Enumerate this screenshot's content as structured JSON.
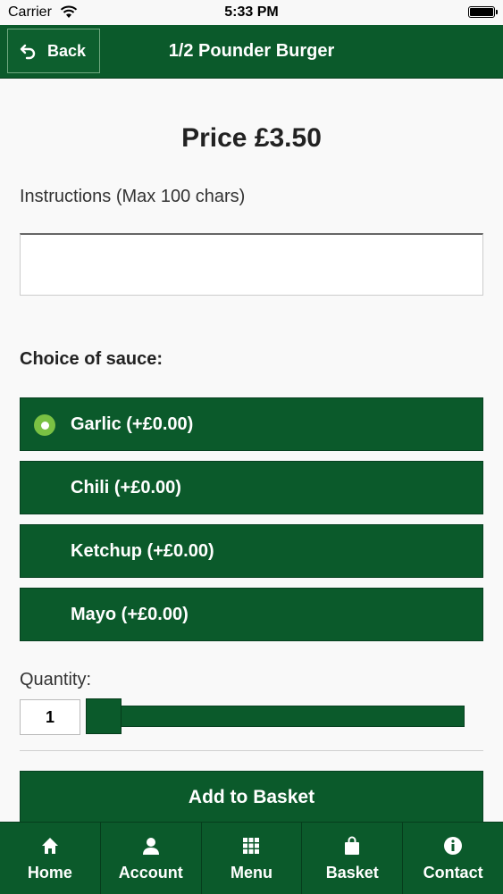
{
  "status_bar": {
    "carrier": "Carrier",
    "time": "5:33 PM"
  },
  "header": {
    "back_label": "Back",
    "title": "1/2 Pounder Burger",
    "color": "#0b5a2b"
  },
  "price": "Price £3.50",
  "instructions": {
    "label": "Instructions (Max 100 chars)",
    "value": ""
  },
  "sauce": {
    "label": "Choice of sauce:",
    "options": [
      {
        "label": "Garlic (+£0.00)",
        "selected": true
      },
      {
        "label": "Chili (+£0.00)",
        "selected": false
      },
      {
        "label": "Ketchup (+£0.00)",
        "selected": false
      },
      {
        "label": "Mayo (+£0.00)",
        "selected": false
      }
    ]
  },
  "quantity": {
    "label": "Quantity:",
    "value": "1"
  },
  "add_button": "Add to Basket",
  "tabs": [
    {
      "label": "Home",
      "icon": "home-icon"
    },
    {
      "label": "Account",
      "icon": "user-icon"
    },
    {
      "label": "Menu",
      "icon": "grid-icon"
    },
    {
      "label": "Basket",
      "icon": "bag-icon"
    },
    {
      "label": "Contact",
      "icon": "info-icon"
    }
  ],
  "colors": {
    "brand_green": "#0b5a2b",
    "radio_selected": "#7ac143"
  }
}
